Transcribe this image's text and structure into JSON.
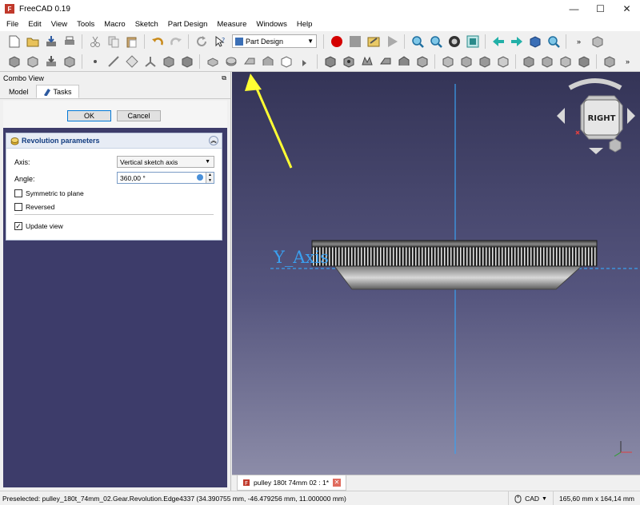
{
  "app": {
    "title": "FreeCAD 0.19",
    "logo_letter": "F"
  },
  "window_controls": {
    "minimize": "—",
    "maximize": "☐",
    "close": "✕"
  },
  "menu": [
    "File",
    "Edit",
    "View",
    "Tools",
    "Macro",
    "Sketch",
    "Part Design",
    "Measure",
    "Windows",
    "Help"
  ],
  "toolbar": {
    "workbench": "Part Design",
    "more": "»"
  },
  "combo_view": {
    "title": "Combo View",
    "float_icon": "⧉",
    "tabs": [
      "Model",
      "Tasks"
    ],
    "active_tab": "Tasks"
  },
  "task": {
    "ok": "OK",
    "cancel": "Cancel",
    "box_title": "Revolution parameters",
    "axis_label": "Axis:",
    "axis_value": "Vertical sketch axis",
    "angle_label": "Angle:",
    "angle_value": "360,00 °",
    "symmetric_label": "Symmetric to plane",
    "symmetric_checked": false,
    "reversed_label": "Reversed",
    "reversed_checked": false,
    "update_view_label": "Update view",
    "update_view_checked": true
  },
  "viewport": {
    "axis_label": "Y_Axis",
    "navcube_face": "RIGHT",
    "axis_color": "#3aa0f0",
    "annotation_color": "#ffff33"
  },
  "document_tab": {
    "label": "pulley 180t 74mm 02 : 1*",
    "close": "✕"
  },
  "statusbar": {
    "message": "Preselected: pulley_180t_74mm_02.Gear.Revolution.Edge4337 (34.390755 mm, -46.479256 mm, 11.000000 mm)",
    "nav_style": "CAD",
    "dimensions": "165,60 mm x 164,14 mm"
  }
}
